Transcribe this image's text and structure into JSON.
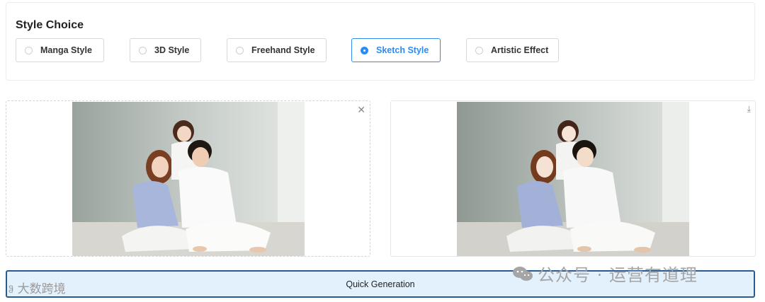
{
  "style_panel": {
    "title": "Style Choice",
    "options": [
      {
        "label": "Manga Style",
        "selected": false
      },
      {
        "label": "3D Style",
        "selected": false
      },
      {
        "label": "Freehand Style",
        "selected": false
      },
      {
        "label": "Sketch Style",
        "selected": true
      },
      {
        "label": "Artistic Effect",
        "selected": false
      }
    ]
  },
  "preview": {
    "left_icon": "close-icon",
    "right_icon": "download-icon"
  },
  "actions": {
    "generate_label": "Quick Generation"
  },
  "watermarks": {
    "left": "大数跨境",
    "right": "公众号 · 运营有道理"
  },
  "colors": {
    "accent": "#2d8cf0",
    "button_bg": "#e3f1fd",
    "button_border": "#2b5a8c"
  }
}
